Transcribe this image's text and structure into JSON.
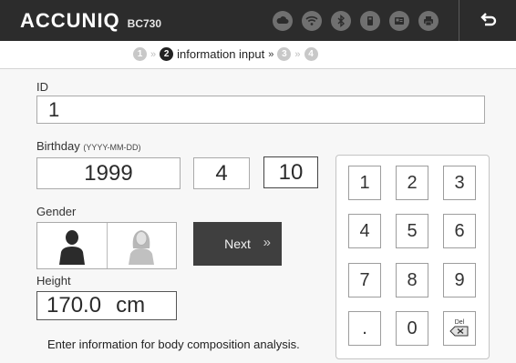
{
  "app": {
    "brand": "ACCUNIQ",
    "model": "BC730"
  },
  "header": {
    "status_icons": [
      "cloud-icon",
      "wifi-icon",
      "bluetooth-icon",
      "usb-memory-icon",
      "id-card-icon",
      "printer-icon"
    ],
    "back_icon": "back-arrow-icon"
  },
  "steps": {
    "items": [
      {
        "number": "1",
        "state": "inactive"
      },
      {
        "number": "2",
        "state": "active",
        "label": "information input"
      },
      {
        "number": "3",
        "state": "inactive"
      },
      {
        "number": "4",
        "state": "inactive"
      }
    ],
    "separator": "»"
  },
  "form": {
    "id": {
      "label": "ID",
      "value": "1"
    },
    "birthday": {
      "label": "Birthday",
      "format_hint": "(YYYY-MM-DD)",
      "year": "1999",
      "month": "4",
      "day": "10"
    },
    "gender": {
      "label": "Gender",
      "options": [
        "male",
        "female"
      ],
      "selected": "male"
    },
    "height": {
      "label": "Height",
      "value": "170.0",
      "unit": "cm"
    },
    "next_label": "Next",
    "next_chevron": "»",
    "hint": "Enter information for body composition analysis."
  },
  "keypad": {
    "keys": [
      "1",
      "2",
      "3",
      "4",
      "5",
      "6",
      "7",
      "8",
      "9",
      ".",
      "0"
    ],
    "delete_label": "Del"
  },
  "colors": {
    "header_bg": "#2c2c2c",
    "active_step": "#222222",
    "inactive_step": "#c8c8c8",
    "next_bg": "#3f3f3f"
  }
}
